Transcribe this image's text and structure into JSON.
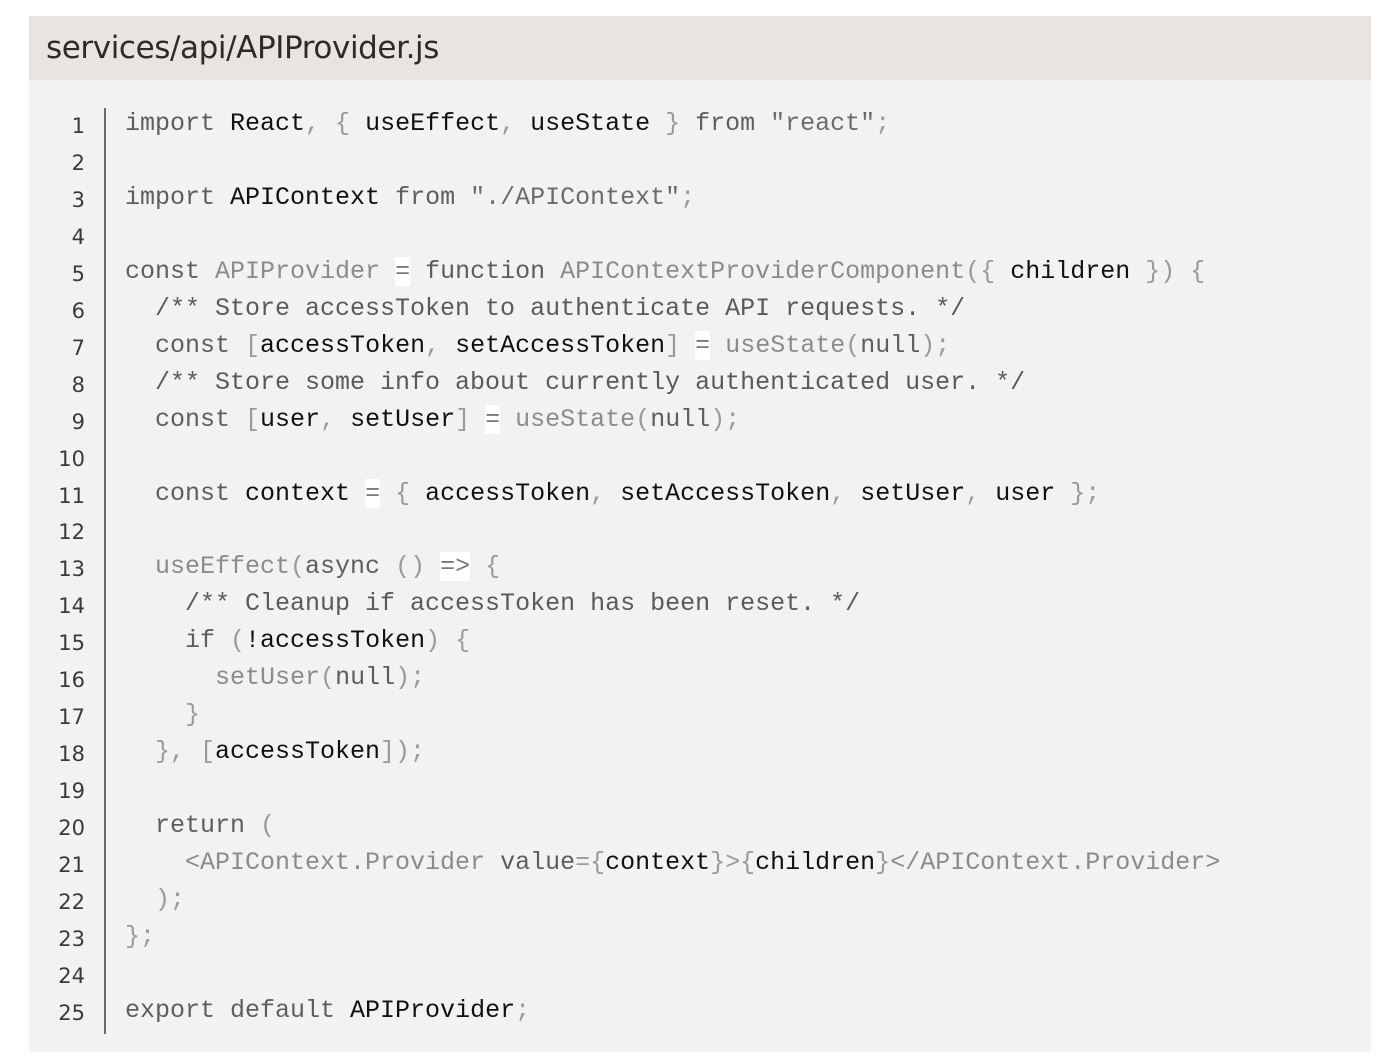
{
  "file": {
    "path": "services/api/APIProvider.js"
  },
  "code": {
    "lines": [
      {
        "n": "1",
        "tokens": [
          [
            "k",
            "import "
          ],
          [
            "i",
            "React"
          ],
          [
            "p",
            ", { "
          ],
          [
            "i",
            "useEffect"
          ],
          [
            "p",
            ", "
          ],
          [
            "i",
            "useState"
          ],
          [
            "p",
            " } "
          ],
          [
            "k",
            "from "
          ],
          [
            "s",
            "\"react\""
          ],
          [
            "p",
            ";"
          ]
        ]
      },
      {
        "n": "2",
        "tokens": []
      },
      {
        "n": "3",
        "tokens": [
          [
            "k",
            "import "
          ],
          [
            "i",
            "APIContext"
          ],
          [
            "k",
            " from "
          ],
          [
            "s",
            "\"./APIContext\""
          ],
          [
            "p",
            ";"
          ]
        ]
      },
      {
        "n": "4",
        "tokens": []
      },
      {
        "n": "5",
        "tokens": [
          [
            "k",
            "const "
          ],
          [
            "f",
            "APIProvider"
          ],
          [
            "p",
            " "
          ],
          [
            "o",
            "="
          ],
          [
            "p",
            " "
          ],
          [
            "k",
            "function "
          ],
          [
            "f",
            "APIContextProviderComponent"
          ],
          [
            "p",
            "({ "
          ],
          [
            "i",
            "children"
          ],
          [
            "p",
            " }) {"
          ]
        ]
      },
      {
        "n": "6",
        "tokens": [
          [
            "c",
            "  /** Store accessToken to authenticate API requests. */"
          ]
        ]
      },
      {
        "n": "7",
        "tokens": [
          [
            "k",
            "  const "
          ],
          [
            "p",
            "["
          ],
          [
            "i",
            "accessToken"
          ],
          [
            "p",
            ", "
          ],
          [
            "i",
            "setAccessToken"
          ],
          [
            "p",
            "] "
          ],
          [
            "o",
            "="
          ],
          [
            "p",
            " "
          ],
          [
            "f",
            "useState"
          ],
          [
            "p",
            "("
          ],
          [
            "k",
            "null"
          ],
          [
            "p",
            ");"
          ]
        ]
      },
      {
        "n": "8",
        "tokens": [
          [
            "c",
            "  /** Store some info about currently authenticated user. */"
          ]
        ]
      },
      {
        "n": "9",
        "tokens": [
          [
            "k",
            "  const "
          ],
          [
            "p",
            "["
          ],
          [
            "i",
            "user"
          ],
          [
            "p",
            ", "
          ],
          [
            "i",
            "setUser"
          ],
          [
            "p",
            "] "
          ],
          [
            "o",
            "="
          ],
          [
            "p",
            " "
          ],
          [
            "f",
            "useState"
          ],
          [
            "p",
            "("
          ],
          [
            "k",
            "null"
          ],
          [
            "p",
            ");"
          ]
        ]
      },
      {
        "n": "10",
        "tokens": []
      },
      {
        "n": "11",
        "tokens": [
          [
            "k",
            "  const "
          ],
          [
            "i",
            "context"
          ],
          [
            "p",
            " "
          ],
          [
            "o",
            "="
          ],
          [
            "p",
            " { "
          ],
          [
            "i",
            "accessToken"
          ],
          [
            "p",
            ", "
          ],
          [
            "i",
            "setAccessToken"
          ],
          [
            "p",
            ", "
          ],
          [
            "i",
            "setUser"
          ],
          [
            "p",
            ", "
          ],
          [
            "i",
            "user"
          ],
          [
            "p",
            " };"
          ]
        ]
      },
      {
        "n": "12",
        "tokens": []
      },
      {
        "n": "13",
        "tokens": [
          [
            "f",
            "  useEffect"
          ],
          [
            "p",
            "("
          ],
          [
            "k",
            "async"
          ],
          [
            "p",
            " () "
          ],
          [
            "o",
            "=>"
          ],
          [
            "p",
            " {"
          ]
        ]
      },
      {
        "n": "14",
        "tokens": [
          [
            "c",
            "    /** Cleanup if accessToken has been reset. */"
          ]
        ]
      },
      {
        "n": "15",
        "tokens": [
          [
            "k",
            "    if "
          ],
          [
            "p",
            "("
          ],
          [
            "i",
            "!accessToken"
          ],
          [
            "p",
            ") {"
          ]
        ]
      },
      {
        "n": "16",
        "tokens": [
          [
            "f",
            "      setUser"
          ],
          [
            "p",
            "("
          ],
          [
            "k",
            "null"
          ],
          [
            "p",
            ");"
          ]
        ]
      },
      {
        "n": "17",
        "tokens": [
          [
            "p",
            "    }"
          ]
        ]
      },
      {
        "n": "18",
        "tokens": [
          [
            "p",
            "  }, ["
          ],
          [
            "i",
            "accessToken"
          ],
          [
            "p",
            "]);"
          ]
        ]
      },
      {
        "n": "19",
        "tokens": []
      },
      {
        "n": "20",
        "tokens": [
          [
            "k",
            "  return "
          ],
          [
            "p",
            "("
          ]
        ]
      },
      {
        "n": "21",
        "tokens": [
          [
            "f",
            "    <APIContext.Provider "
          ],
          [
            "k",
            "value"
          ],
          [
            "p",
            "={"
          ],
          [
            "i",
            "context"
          ],
          [
            "p",
            "}>{"
          ],
          [
            "i",
            "children"
          ],
          [
            "p",
            "}"
          ],
          [
            "f",
            "</APIContext.Provider>"
          ]
        ]
      },
      {
        "n": "22",
        "tokens": [
          [
            "p",
            "  );"
          ]
        ]
      },
      {
        "n": "23",
        "tokens": [
          [
            "p",
            "};"
          ]
        ]
      },
      {
        "n": "24",
        "tokens": []
      },
      {
        "n": "25",
        "tokens": [
          [
            "k",
            "export default "
          ],
          [
            "i",
            "APIProvider"
          ],
          [
            "p",
            ";"
          ]
        ]
      }
    ]
  }
}
